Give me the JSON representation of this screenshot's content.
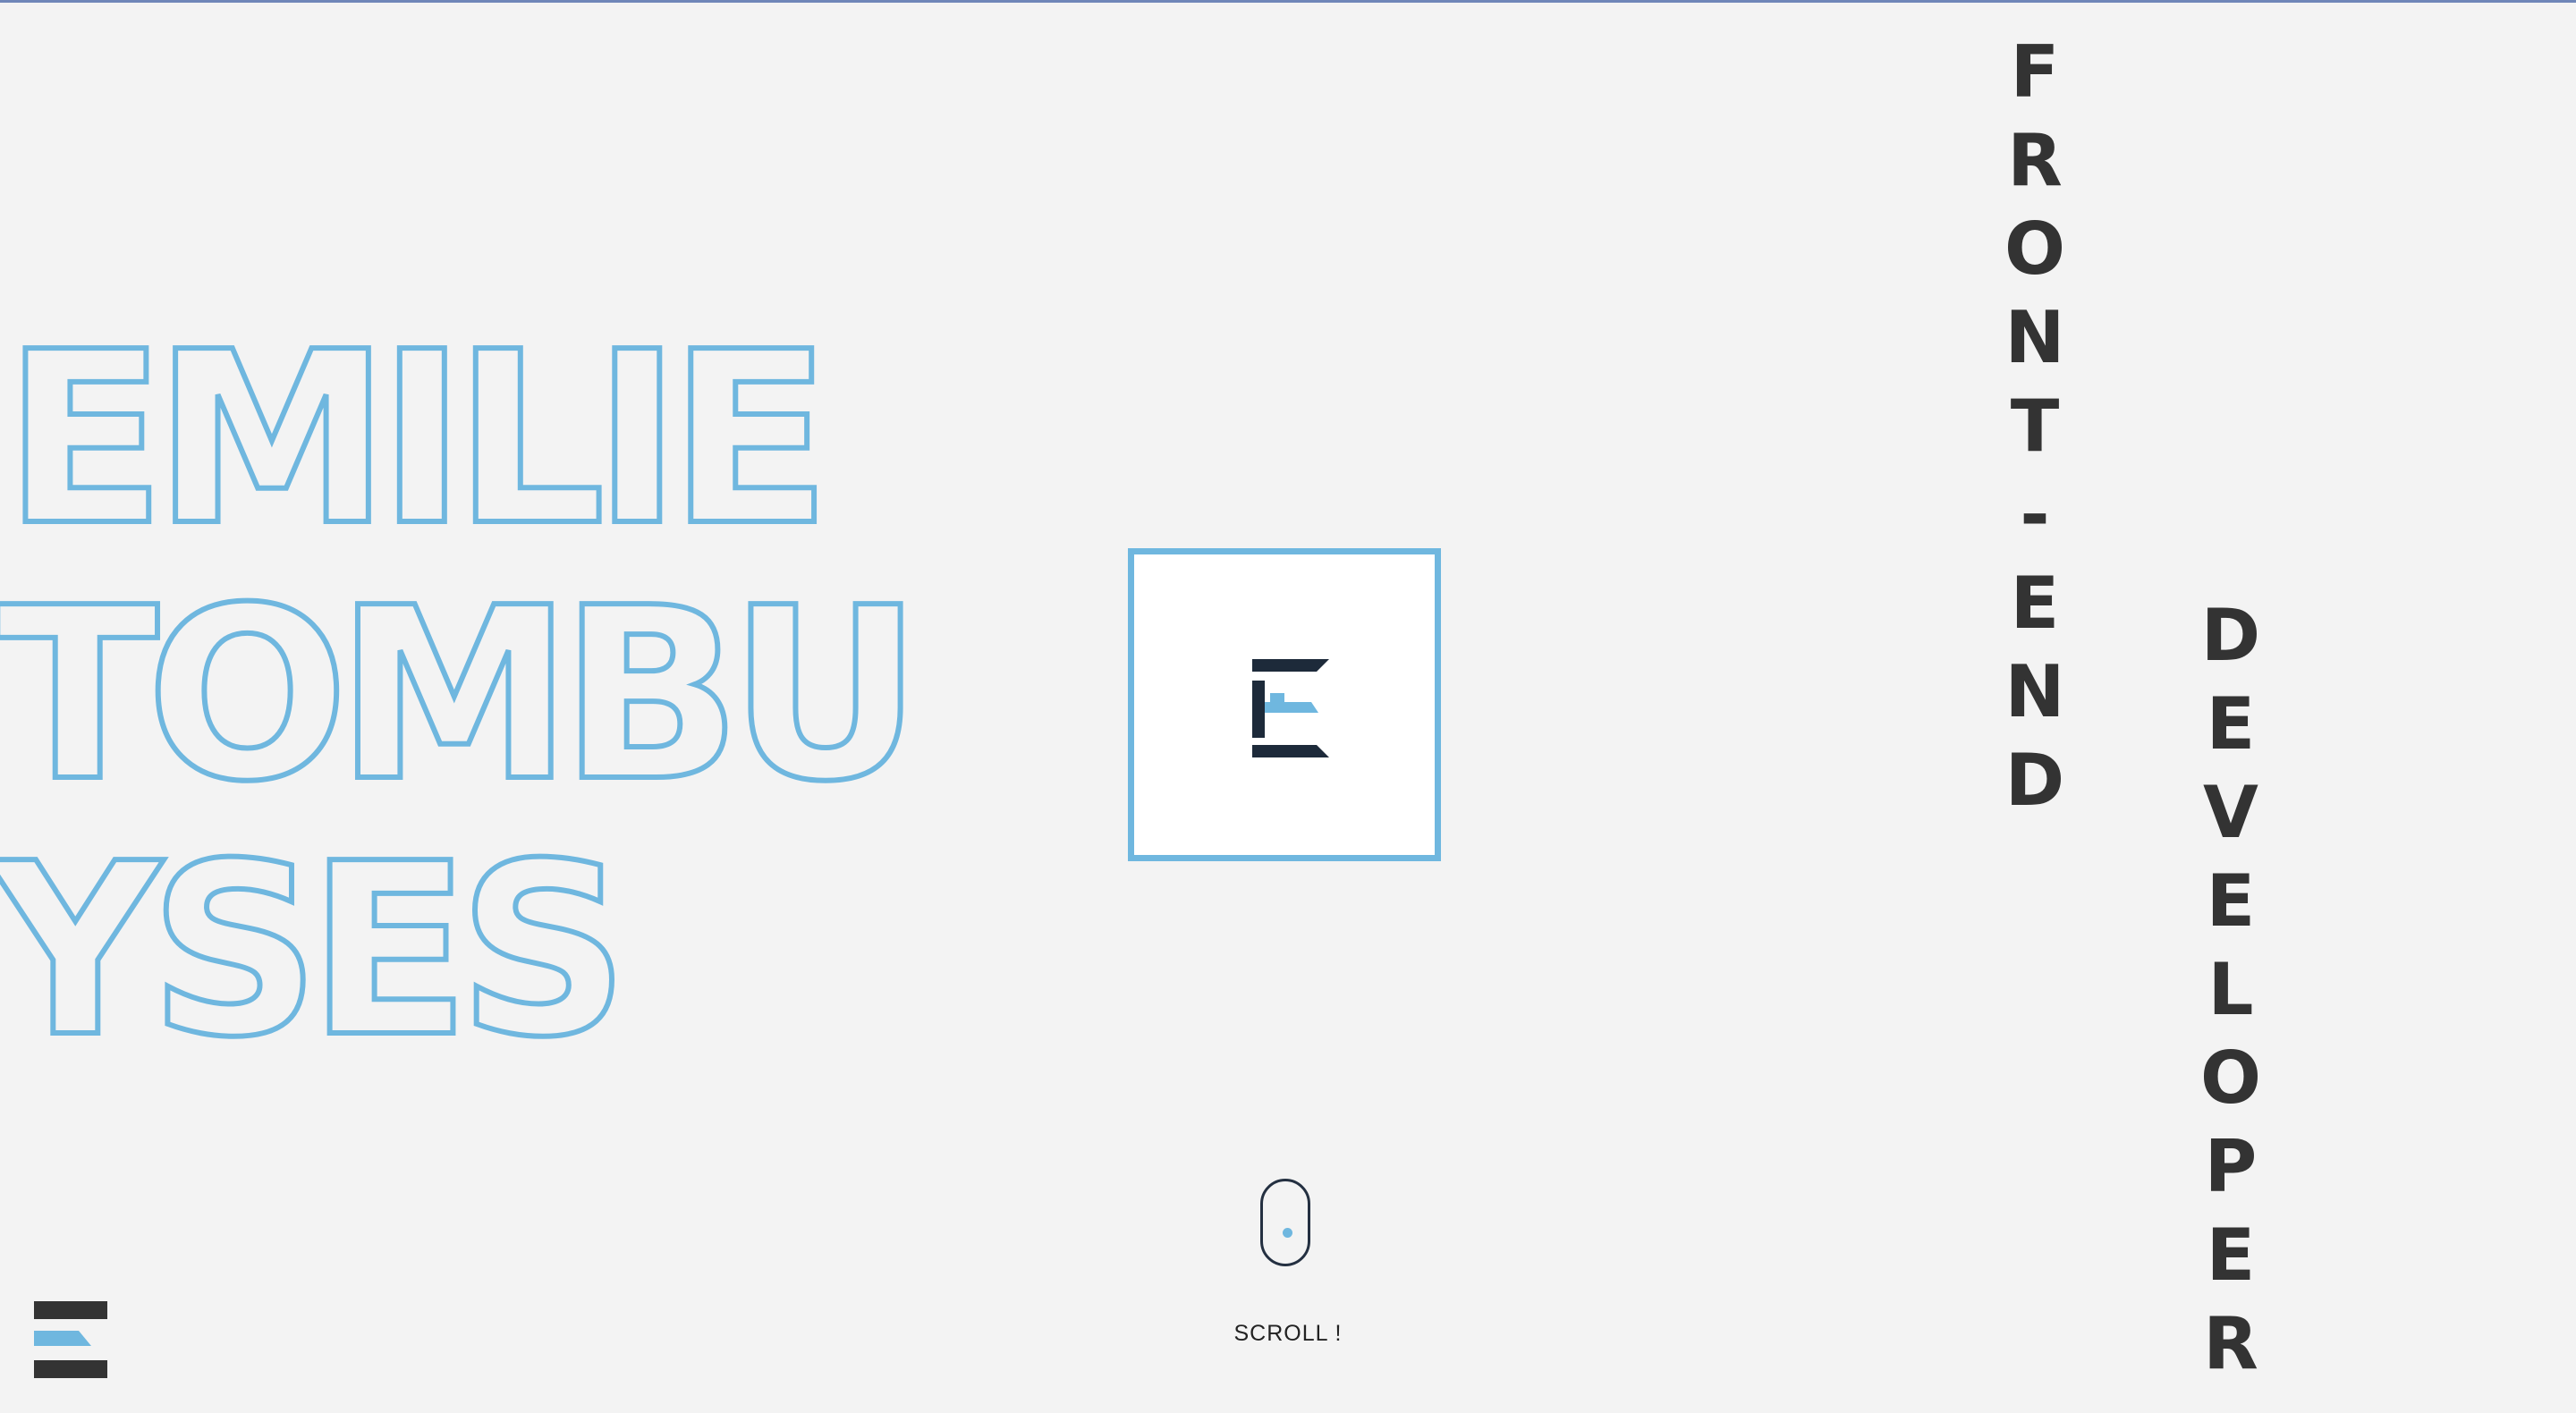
{
  "hero": {
    "name_lines": [
      "EMILIE",
      "TOMBU",
      "YSES"
    ]
  },
  "roles": {
    "primary": [
      "F",
      "R",
      "O",
      "N",
      "T",
      "-",
      "E",
      "N",
      "D"
    ],
    "secondary": [
      "D",
      "E",
      "V",
      "E",
      "L",
      "O",
      "P",
      "E",
      "R"
    ]
  },
  "logo": {
    "letter_icon": "e-monogram-icon"
  },
  "scroll": {
    "label": "SCROLL !",
    "icon": "mouse-icon"
  },
  "menu": {
    "icon": "hamburger-menu-icon"
  },
  "colors": {
    "background": "#f3f3f3",
    "accent": "#6fb7df",
    "dark": "#333333",
    "navy": "#1d2a3a",
    "top_rule": "#6f86b8"
  }
}
